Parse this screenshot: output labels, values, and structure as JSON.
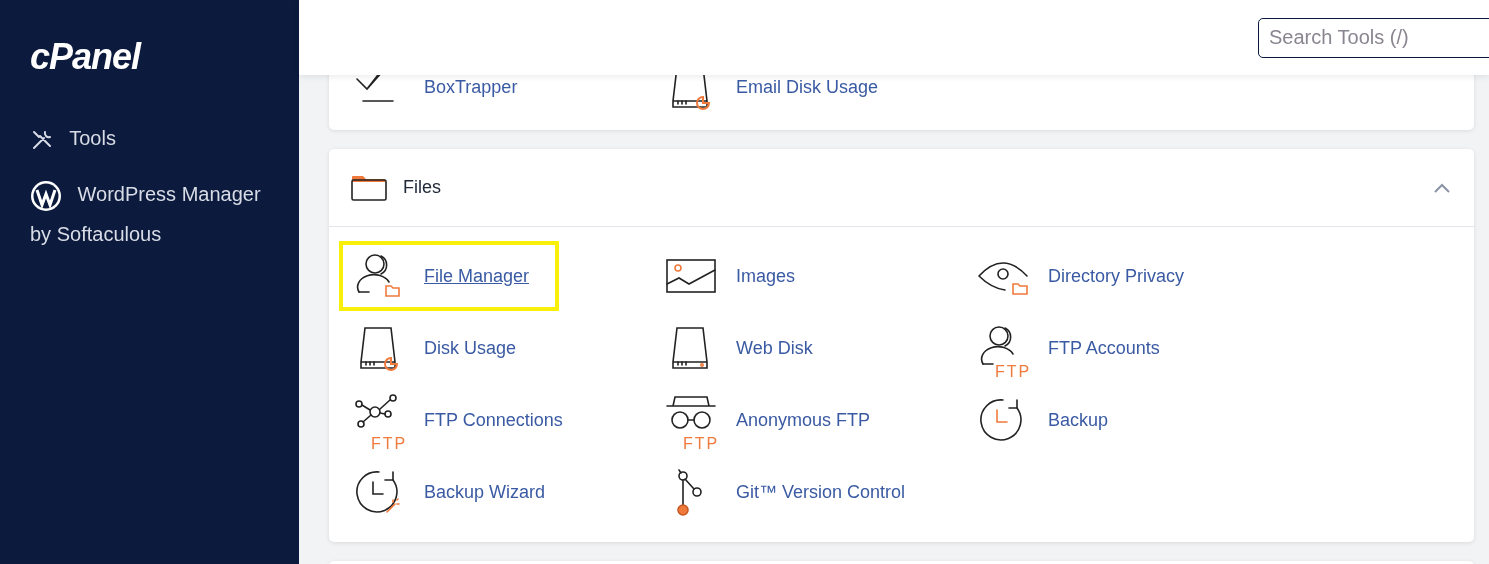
{
  "sidebar": {
    "logo": "cPanel",
    "items": [
      {
        "label": "Tools",
        "kind": "tools"
      },
      {
        "label": "WordPress Manager by Softaculous",
        "kind": "wordpress"
      }
    ]
  },
  "search": {
    "placeholder": "Search Tools (/)"
  },
  "sections": [
    {
      "items": [
        {
          "label": "BoxTrapper",
          "kind": "boxtrapper",
          "highlighted": false
        },
        {
          "label": "Email Disk Usage",
          "kind": "disk-chart",
          "highlighted": false
        }
      ]
    },
    {
      "title": "Files",
      "expanded": true,
      "items": [
        {
          "label": "File Manager",
          "kind": "user-folder",
          "highlighted": true
        },
        {
          "label": "Images",
          "kind": "image",
          "highlighted": false
        },
        {
          "label": "Directory Privacy",
          "kind": "eye-folder",
          "highlighted": false
        },
        {
          "label": "Disk Usage",
          "kind": "disk-chart",
          "highlighted": false
        },
        {
          "label": "Web Disk",
          "kind": "disk",
          "highlighted": false
        },
        {
          "label": "FTP Accounts",
          "kind": "user",
          "badge": "FTP",
          "highlighted": false
        },
        {
          "label": "FTP Connections",
          "kind": "network",
          "badge": "FTP",
          "highlighted": false
        },
        {
          "label": "Anonymous FTP",
          "kind": "spy",
          "badge": "FTP",
          "highlighted": false
        },
        {
          "label": "Backup",
          "kind": "clock",
          "highlighted": false
        },
        {
          "label": "Backup Wizard",
          "kind": "clock-wand",
          "highlighted": false
        },
        {
          "label": "Git™ Version Control",
          "kind": "git",
          "highlighted": false
        }
      ]
    }
  ]
}
